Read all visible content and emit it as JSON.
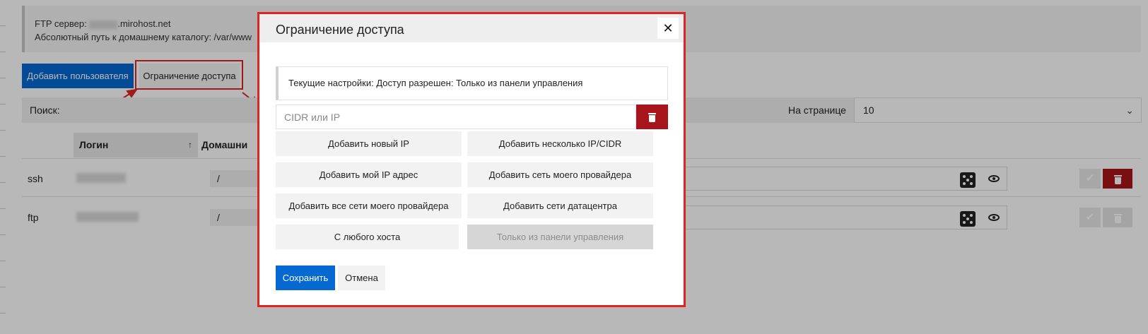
{
  "info": {
    "ftp_server_label": "FTP сервер:",
    "ftp_server_host": ".mirohost.net",
    "home_path_label": "Абсолютный путь к домашнему каталогу: /var/www"
  },
  "toolbar": {
    "add_user": "Добавить пользователя",
    "access_restriction": "Ограничение доступа"
  },
  "search": {
    "label": "Поиск:"
  },
  "per_page": {
    "label": "На странице",
    "value": "10"
  },
  "table": {
    "columns": {
      "login": "Логин",
      "sort_indicator": "↑",
      "home": "Домашни"
    },
    "rows": [
      {
        "name": "ssh",
        "home": "/"
      },
      {
        "name": "ftp",
        "home": "/"
      }
    ]
  },
  "modal": {
    "title": "Ограничение доступа",
    "close": "✕",
    "current_settings": "Текущие настройки: Доступ разрешен: Только из панели управления",
    "cidr_placeholder": "CIDR или IP",
    "buttons": {
      "add_new_ip": "Добавить новый IP",
      "add_multiple": "Добавить несколько IP/CIDR",
      "add_my_ip": "Добавить мой IP адрес",
      "add_provider_net": "Добавить сеть моего провайдера",
      "add_all_provider_nets": "Добавить все сети моего провайдера",
      "add_datacenter_nets": "Добавить сети датацентра",
      "any_host": "С любого хоста",
      "panel_only": "Только из панели управления"
    },
    "save": "Сохранить",
    "cancel": "Отмена"
  },
  "colors": {
    "primary": "#0668d1",
    "danger": "#a8141b",
    "annotation": "#e02424"
  }
}
